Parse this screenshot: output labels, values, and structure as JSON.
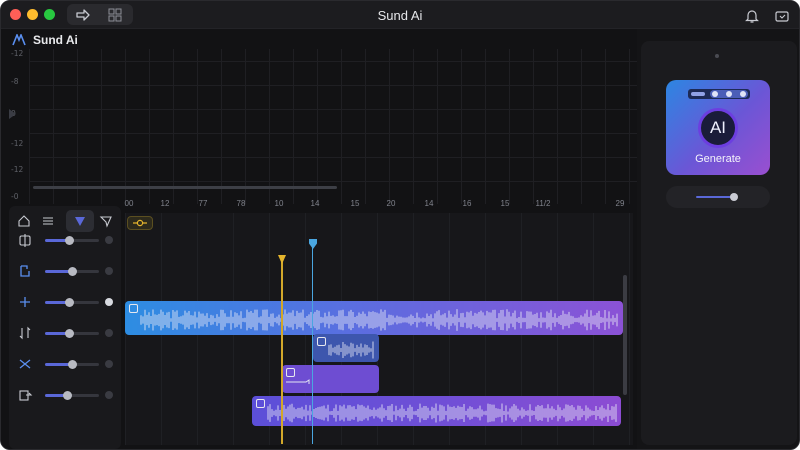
{
  "window": {
    "title": "Sund Ai"
  },
  "app": {
    "name": "Sund Ai"
  },
  "waveform": {
    "y_labels": [
      "-12",
      "-8",
      "0",
      "-12",
      "-12",
      "-0"
    ]
  },
  "ruler": {
    "ticks": [
      "00",
      "12",
      "77",
      "78",
      "10",
      "14",
      "15",
      "20",
      "14",
      "16",
      "15",
      "11/2",
      "29"
    ]
  },
  "tracks": [
    {
      "icon": "split-icon",
      "level": 0.45,
      "end_dot": "off"
    },
    {
      "icon": "loop-icon",
      "level": 0.5,
      "end_dot": "off"
    },
    {
      "icon": "plus-icon",
      "level": 0.45,
      "end_dot": "on"
    },
    {
      "icon": "sort-icon",
      "level": 0.45,
      "end_dot": "off"
    },
    {
      "icon": "shuffle-icon",
      "level": 0.5,
      "end_dot": "off"
    },
    {
      "icon": "export-icon",
      "level": 0.4,
      "end_dot": "off"
    }
  ],
  "generate": {
    "badge": "AI",
    "label": "Generate"
  },
  "colors": {
    "accent_blue": "#2f8fe0",
    "accent_purple": "#8a4fd8",
    "playhead_yellow": "#e5b52d",
    "playhead_blue": "#4aa6e0"
  }
}
